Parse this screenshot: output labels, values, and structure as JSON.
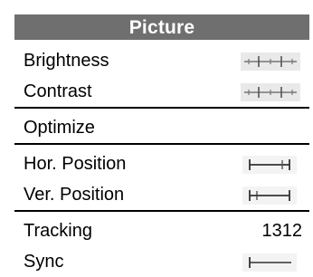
{
  "menu": {
    "title": "Picture",
    "items": [
      {
        "label": "Brightness",
        "icon": "brightness-slider-icon"
      },
      {
        "label": "Contrast",
        "icon": "contrast-slider-icon"
      },
      {
        "label": "Optimize",
        "icon": ""
      },
      {
        "label": "Hor. Position",
        "icon": "horizontal-position-icon"
      },
      {
        "label": "Ver. Position",
        "icon": "vertical-position-icon"
      },
      {
        "label": "Tracking",
        "value": "1312"
      },
      {
        "label": "Sync",
        "icon": "sync-icon"
      }
    ]
  },
  "colors": {
    "title_bar": "#6f6f6f",
    "title_text": "#ffffff",
    "divider": "#000000",
    "icon_bg": "#e9e9e9"
  }
}
